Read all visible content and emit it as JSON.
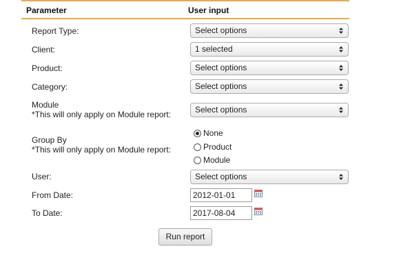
{
  "header": {
    "col_param": "Parameter",
    "col_input": "User input"
  },
  "rows": {
    "report_type": {
      "label": "Report Type:",
      "value": "Select options"
    },
    "client": {
      "label": "Client:",
      "value": "1 selected"
    },
    "product": {
      "label": "Product:",
      "value": "Select options"
    },
    "category": {
      "label": "Category:",
      "value": "Select options"
    },
    "module": {
      "label": "Module",
      "note": "*This will only apply on Module report:",
      "value": "Select options"
    },
    "group_by": {
      "label": "Group By",
      "note": "*This will only apply on Module report:",
      "options": [
        "None",
        "Product",
        "Module"
      ],
      "selected": "None"
    },
    "user": {
      "label": "User:",
      "value": "Select options"
    },
    "from_date": {
      "label": "From Date:",
      "value": "2012-01-01"
    },
    "to_date": {
      "label": "To Date:",
      "value": "2017-08-04"
    }
  },
  "actions": {
    "run_label": "Run report"
  },
  "icons": {
    "select_arrow": "updown-arrow-icon",
    "calendar": "calendar-icon"
  },
  "colors": {
    "accent": "#e8a74f"
  }
}
